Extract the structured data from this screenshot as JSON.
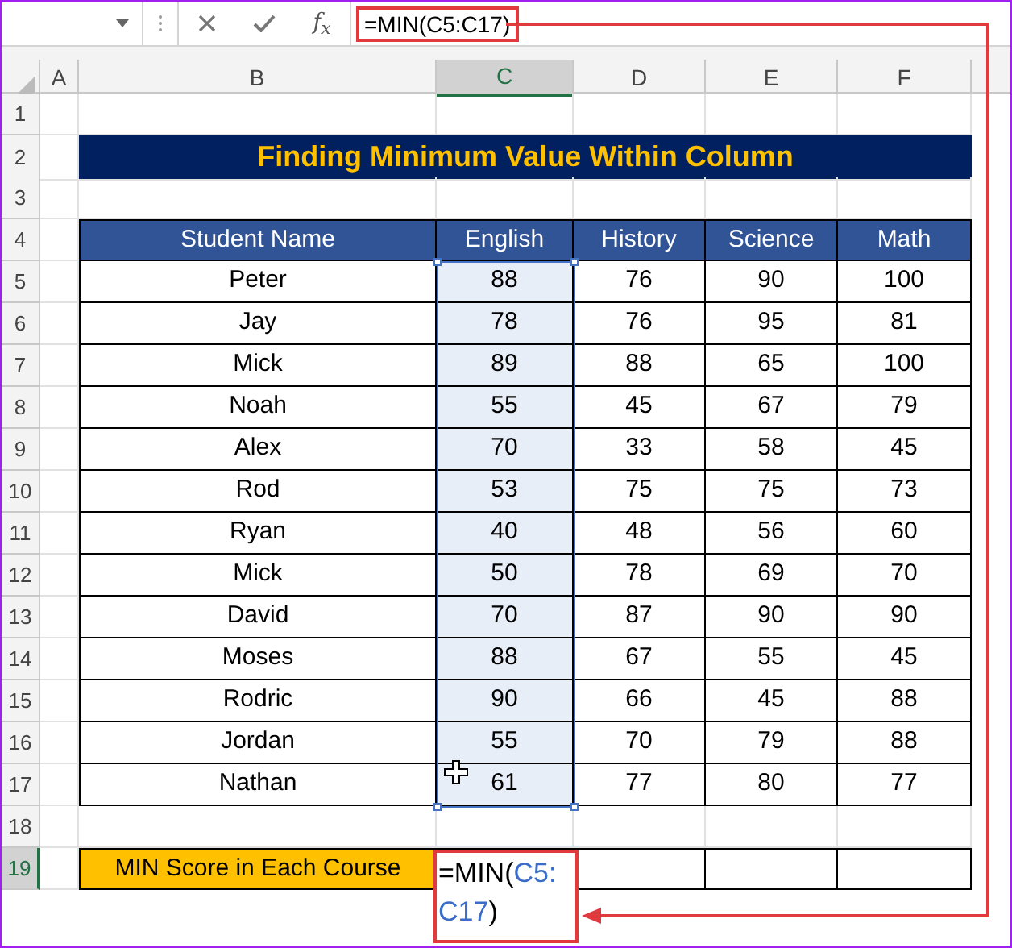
{
  "formula_bar": {
    "function_label": "f$_{x}$",
    "formula": "=MIN(C5:C17)"
  },
  "column_headers": [
    {
      "label": "A",
      "selected": false
    },
    {
      "label": "B",
      "selected": false
    },
    {
      "label": "C",
      "selected": true
    },
    {
      "label": "D",
      "selected": false
    },
    {
      "label": "E",
      "selected": false
    },
    {
      "label": "F",
      "selected": false
    }
  ],
  "row_headers": [
    {
      "label": "1",
      "selected": false
    },
    {
      "label": "2",
      "selected": false
    },
    {
      "label": "3",
      "selected": false
    },
    {
      "label": "4",
      "selected": false
    },
    {
      "label": "5",
      "selected": false
    },
    {
      "label": "6",
      "selected": false
    },
    {
      "label": "7",
      "selected": false
    },
    {
      "label": "8",
      "selected": false
    },
    {
      "label": "9",
      "selected": false
    },
    {
      "label": "10",
      "selected": false
    },
    {
      "label": "11",
      "selected": false
    },
    {
      "label": "12",
      "selected": false
    },
    {
      "label": "13",
      "selected": false
    },
    {
      "label": "14",
      "selected": false
    },
    {
      "label": "15",
      "selected": false
    },
    {
      "label": "16",
      "selected": false
    },
    {
      "label": "17",
      "selected": false
    },
    {
      "label": "18",
      "selected": false
    },
    {
      "label": "19",
      "selected": true
    }
  ],
  "title": "Finding Minimum Value Within Column",
  "table": {
    "columns": [
      "Student Name",
      "English",
      "History",
      "Science",
      "Math"
    ],
    "rows": [
      [
        {
          "text": "Peter",
          "selected": false
        },
        {
          "text": "88",
          "selected": true
        },
        {
          "text": "76",
          "selected": false
        },
        {
          "text": "90",
          "selected": false
        },
        {
          "text": "100",
          "selected": false
        }
      ],
      [
        {
          "text": "Jay",
          "selected": false
        },
        {
          "text": "78",
          "selected": true
        },
        {
          "text": "76",
          "selected": false
        },
        {
          "text": "95",
          "selected": false
        },
        {
          "text": "81",
          "selected": false
        }
      ],
      [
        {
          "text": "Mick",
          "selected": false
        },
        {
          "text": "89",
          "selected": true
        },
        {
          "text": "88",
          "selected": false
        },
        {
          "text": "65",
          "selected": false
        },
        {
          "text": "100",
          "selected": false
        }
      ],
      [
        {
          "text": "Noah",
          "selected": false
        },
        {
          "text": "55",
          "selected": true
        },
        {
          "text": "45",
          "selected": false
        },
        {
          "text": "67",
          "selected": false
        },
        {
          "text": "79",
          "selected": false
        }
      ],
      [
        {
          "text": "Alex",
          "selected": false
        },
        {
          "text": "70",
          "selected": true
        },
        {
          "text": "33",
          "selected": false
        },
        {
          "text": "58",
          "selected": false
        },
        {
          "text": "45",
          "selected": false
        }
      ],
      [
        {
          "text": "Rod",
          "selected": false
        },
        {
          "text": "53",
          "selected": true
        },
        {
          "text": "75",
          "selected": false
        },
        {
          "text": "75",
          "selected": false
        },
        {
          "text": "73",
          "selected": false
        }
      ],
      [
        {
          "text": "Ryan",
          "selected": false
        },
        {
          "text": "40",
          "selected": true
        },
        {
          "text": "48",
          "selected": false
        },
        {
          "text": "56",
          "selected": false
        },
        {
          "text": "60",
          "selected": false
        }
      ],
      [
        {
          "text": "Mick",
          "selected": false
        },
        {
          "text": "50",
          "selected": true
        },
        {
          "text": "78",
          "selected": false
        },
        {
          "text": "69",
          "selected": false
        },
        {
          "text": "70",
          "selected": false
        }
      ],
      [
        {
          "text": "David",
          "selected": false
        },
        {
          "text": "70",
          "selected": true
        },
        {
          "text": "87",
          "selected": false
        },
        {
          "text": "90",
          "selected": false
        },
        {
          "text": "90",
          "selected": false
        }
      ],
      [
        {
          "text": "Moses",
          "selected": false
        },
        {
          "text": "88",
          "selected": true
        },
        {
          "text": "67",
          "selected": false
        },
        {
          "text": "55",
          "selected": false
        },
        {
          "text": "45",
          "selected": false
        }
      ],
      [
        {
          "text": "Rodric",
          "selected": false
        },
        {
          "text": "90",
          "selected": true
        },
        {
          "text": "66",
          "selected": false
        },
        {
          "text": "45",
          "selected": false
        },
        {
          "text": "88",
          "selected": false
        }
      ],
      [
        {
          "text": "Jordan",
          "selected": false
        },
        {
          "text": "55",
          "selected": true
        },
        {
          "text": "70",
          "selected": false
        },
        {
          "text": "79",
          "selected": false
        },
        {
          "text": "88",
          "selected": false
        }
      ],
      [
        {
          "text": "Nathan",
          "selected": false
        },
        {
          "text": "61",
          "selected": true
        },
        {
          "text": "77",
          "selected": false
        },
        {
          "text": "80",
          "selected": false
        },
        {
          "text": "77",
          "selected": false
        }
      ]
    ]
  },
  "summary": {
    "label": "MIN Score in Each Course",
    "editing_cell": {
      "lines": [
        [
          {
            "text": "=MIN(",
            "kind": "plain"
          },
          {
            "text": "C5:",
            "kind": "ref"
          }
        ],
        [
          {
            "text": "C17",
            "kind": "ref"
          },
          {
            "text": ")",
            "kind": "plain"
          }
        ]
      ]
    }
  }
}
